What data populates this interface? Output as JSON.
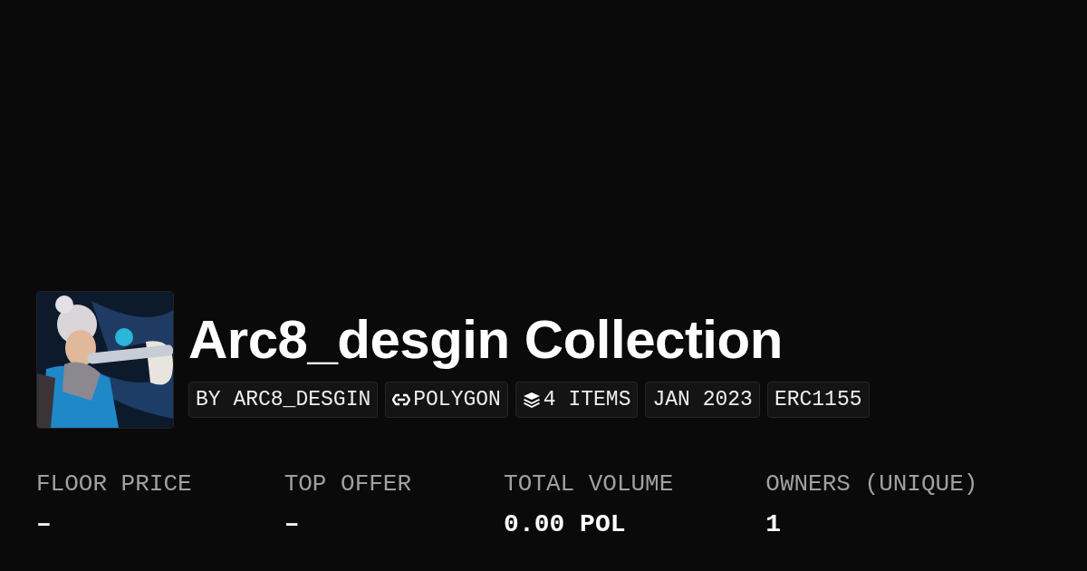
{
  "collection": {
    "title": "Arc8_desgin Collection",
    "tags": [
      {
        "kind": "text",
        "label": "BY ARC8_DESGIN"
      },
      {
        "kind": "chain",
        "label": "POLYGON"
      },
      {
        "kind": "layers",
        "label": "4 ITEMS"
      },
      {
        "kind": "text",
        "label": "JAN 2023"
      },
      {
        "kind": "text",
        "label": "ERC1155"
      }
    ]
  },
  "stats": [
    {
      "label": "FLOOR PRICE",
      "value": "–"
    },
    {
      "label": "TOP OFFER",
      "value": "–"
    },
    {
      "label": "TOTAL VOLUME",
      "value": "0.00 POL"
    },
    {
      "label": "OWNERS (UNIQUE)",
      "value": "1"
    }
  ]
}
